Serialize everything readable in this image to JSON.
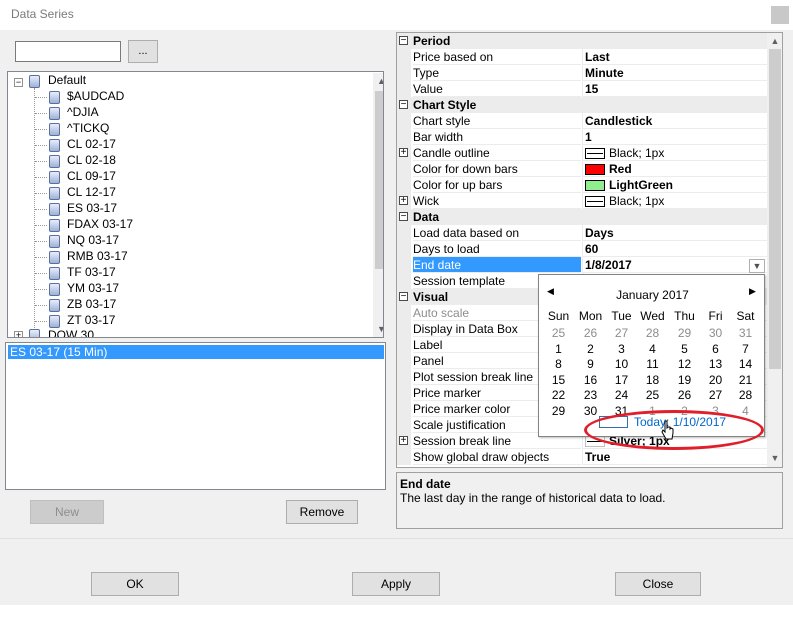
{
  "window": {
    "title": "Data Series"
  },
  "left": {
    "search_value": "",
    "browse_label": "...",
    "tree": {
      "root": "Default",
      "items": [
        "$AUDCAD",
        "^DJIA",
        "^TICKQ",
        "CL 02-17",
        "CL 02-18",
        "CL 09-17",
        "CL 12-17",
        "ES 03-17",
        "FDAX 03-17",
        "NQ 03-17",
        "RMB 03-17",
        "TF 03-17",
        "YM 03-17",
        "ZB 03-17",
        "ZT 03-17"
      ],
      "partial_root": "DOW 30"
    },
    "selected_series": "ES 03-17 (15 Min)",
    "new_label": "New",
    "remove_label": "Remove"
  },
  "grid": {
    "cat_period": "Period",
    "price_based_on": {
      "name": "Price based on",
      "value": "Last"
    },
    "type": {
      "name": "Type",
      "value": "Minute"
    },
    "value": {
      "name": "Value",
      "value": "15"
    },
    "cat_chart_style": "Chart Style",
    "chart_style": {
      "name": "Chart style",
      "value": "Candlestick"
    },
    "bar_width": {
      "name": "Bar width",
      "value": "1"
    },
    "candle_outline": {
      "name": "Candle outline",
      "value": "Black; 1px"
    },
    "color_down": {
      "name": "Color for down bars",
      "value": "Red",
      "color": "#ff0000"
    },
    "color_up": {
      "name": "Color for up bars",
      "value": "LightGreen",
      "color": "#90ee90"
    },
    "wick": {
      "name": "Wick",
      "value": "Black; 1px"
    },
    "cat_data": "Data",
    "load_data": {
      "name": "Load data based on",
      "value": "Days"
    },
    "days_to_load": {
      "name": "Days to load",
      "value": "60"
    },
    "end_date": {
      "name": "End date",
      "value": "1/8/2017"
    },
    "session_template": {
      "name": "Session template"
    },
    "cat_visual": "Visual",
    "auto_scale": {
      "name": "Auto scale"
    },
    "display_in_data_box": {
      "name": "Display in Data Box"
    },
    "label": {
      "name": "Label"
    },
    "panel": {
      "name": "Panel"
    },
    "plot_session_break": {
      "name": "Plot session break line"
    },
    "price_marker": {
      "name": "Price marker"
    },
    "price_marker_color": {
      "name": "Price marker color"
    },
    "scale_justification": {
      "name": "Scale justification"
    },
    "session_break_line": {
      "name": "Session break line",
      "value": "Silver; 1px"
    },
    "show_global_draw": {
      "name": "Show global draw objects",
      "value": "True"
    }
  },
  "description": {
    "title": "End date",
    "text": "The last day in the range of historical data to load."
  },
  "calendar": {
    "month": "January 2017",
    "days_of_week": [
      "Sun",
      "Mon",
      "Tue",
      "Wed",
      "Thu",
      "Fri",
      "Sat"
    ],
    "weeks": [
      [
        "25",
        "26",
        "27",
        "28",
        "29",
        "30",
        "31"
      ],
      [
        "1",
        "2",
        "3",
        "4",
        "5",
        "6",
        "7"
      ],
      [
        "8",
        "9",
        "10",
        "11",
        "12",
        "13",
        "14"
      ],
      [
        "15",
        "16",
        "17",
        "18",
        "19",
        "20",
        "21"
      ],
      [
        "22",
        "23",
        "24",
        "25",
        "26",
        "27",
        "28"
      ],
      [
        "29",
        "30",
        "31",
        "1",
        "2",
        "3",
        "4"
      ]
    ],
    "selected_day": "8",
    "today_day": "10",
    "today_label": "Today: 1/10/2017"
  },
  "buttons": {
    "ok": "OK",
    "apply": "Apply",
    "close": "Close"
  },
  "colors": {
    "selection": "#3399ff",
    "highlight_circle": "#e01f2b",
    "link": "#0066cc"
  }
}
